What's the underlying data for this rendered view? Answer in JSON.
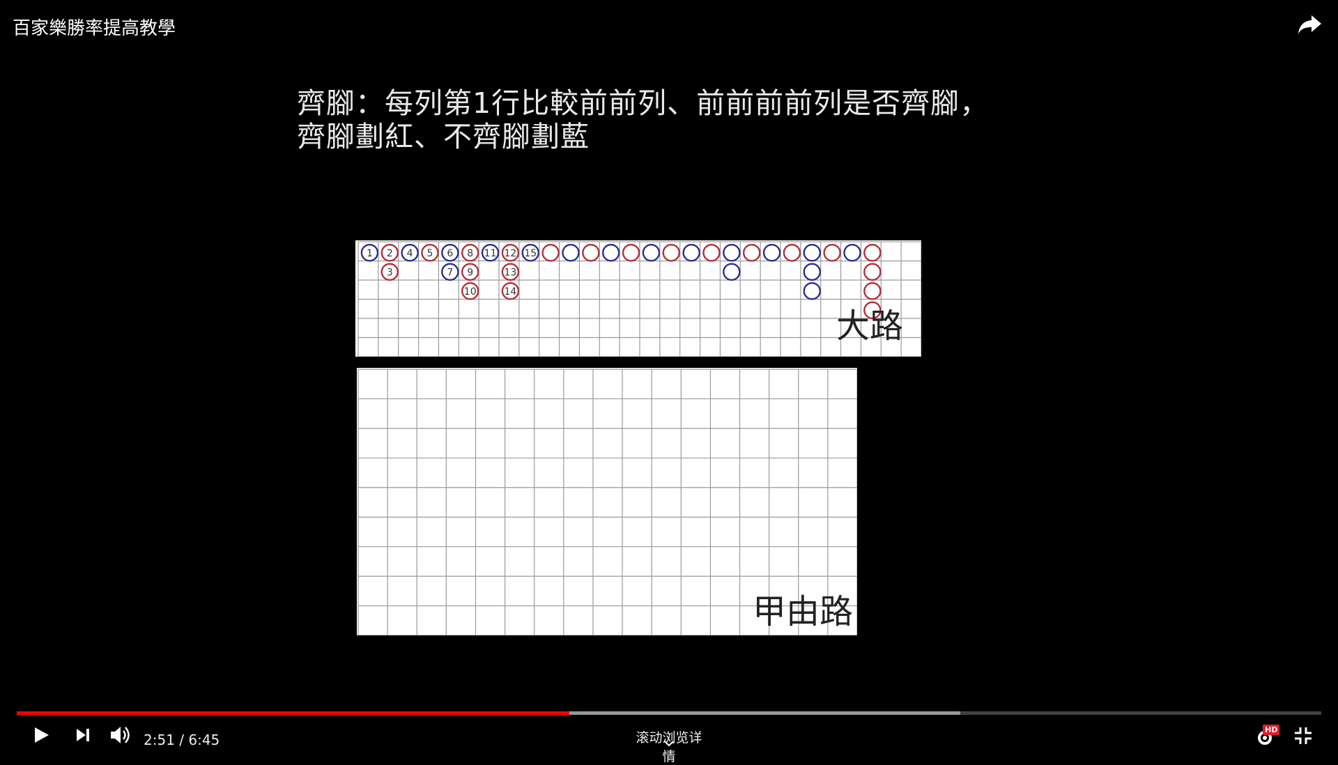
{
  "video": {
    "title": "百家樂勝率提高教學"
  },
  "slide": {
    "heading_lines": [
      "齊腳：每列第1行比較前前列、前前前前列是否齊腳，",
      "齊腳劃紅、不齊腳劃藍"
    ],
    "big_road": {
      "label": "大路",
      "columns": 28,
      "rows": 6,
      "columns_data": [
        [
          {
            "c": "blue",
            "n": "1"
          }
        ],
        [
          {
            "c": "red",
            "n": "2"
          },
          {
            "c": "red",
            "n": "3"
          }
        ],
        [
          {
            "c": "blue",
            "n": "4"
          }
        ],
        [
          {
            "c": "red",
            "n": "5"
          }
        ],
        [
          {
            "c": "blue",
            "n": "6"
          },
          {
            "c": "blue",
            "n": "7"
          }
        ],
        [
          {
            "c": "red",
            "n": "8"
          },
          {
            "c": "red",
            "n": "9"
          },
          {
            "c": "red",
            "n": "10"
          }
        ],
        [
          {
            "c": "blue",
            "n": "11"
          }
        ],
        [
          {
            "c": "red",
            "n": "12"
          },
          {
            "c": "red",
            "n": "13"
          },
          {
            "c": "red",
            "n": "14"
          }
        ],
        [
          {
            "c": "blue",
            "n": "15"
          }
        ],
        [
          {
            "c": "red"
          }
        ],
        [
          {
            "c": "blue"
          }
        ],
        [
          {
            "c": "red"
          }
        ],
        [
          {
            "c": "blue"
          }
        ],
        [
          {
            "c": "red"
          }
        ],
        [
          {
            "c": "blue"
          }
        ],
        [
          {
            "c": "red"
          }
        ],
        [
          {
            "c": "blue"
          }
        ],
        [
          {
            "c": "red"
          }
        ],
        [
          {
            "c": "blue"
          },
          {
            "c": "blue"
          }
        ],
        [
          {
            "c": "red"
          }
        ],
        [
          {
            "c": "blue"
          }
        ],
        [
          {
            "c": "red"
          }
        ],
        [
          {
            "c": "blue"
          },
          {
            "c": "blue"
          },
          {
            "c": "blue"
          }
        ],
        [
          {
            "c": "red"
          }
        ],
        [
          {
            "c": "blue"
          }
        ],
        [
          {
            "c": "red"
          },
          {
            "c": "red"
          },
          {
            "c": "red"
          },
          {
            "c": "red"
          }
        ]
      ]
    },
    "jia_road": {
      "label": "甲由路",
      "columns": 17,
      "rows": 9
    }
  },
  "player": {
    "current_time": "2:51",
    "separator": "/",
    "duration": "6:45",
    "time_text": "2:51 / 6:45",
    "progress_fraction": 0.4235,
    "buffered_fraction": 0.7235,
    "scroll_hint": "滚动浏览详情",
    "hd_label": "HD",
    "colors": {
      "played": "#ff0000",
      "red_bead": "#b0303a",
      "blue_bead": "#2a2f8c"
    },
    "icons": [
      "play-icon",
      "next-icon",
      "volume-icon",
      "settings-icon",
      "exit-fullscreen-icon",
      "share-icon",
      "chevron-down-icon"
    ]
  }
}
